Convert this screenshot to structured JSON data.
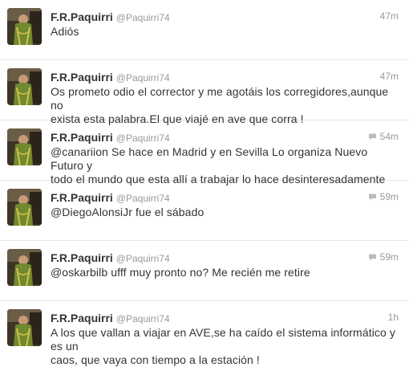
{
  "tweets": [
    {
      "name": "F.R.Paquirri",
      "handle": "@Paquirri74",
      "time": "47m",
      "has_reply_icon": false,
      "lines": [
        "Adiós"
      ]
    },
    {
      "name": "F.R.Paquirri",
      "handle": "@Paquirri74",
      "time": "47m",
      "has_reply_icon": false,
      "lines": [
        "Os prometo odio el corrector y me agotáis los corregidores,aunque no",
        "exista esta palabra.El que viajé en ave que corra !"
      ]
    },
    {
      "name": "F.R.Paquirri",
      "handle": "@Paquirri74",
      "time": "54m",
      "has_reply_icon": true,
      "lines": [
        "@canariion Se hace en Madrid y en Sevilla Lo organiza Nuevo Futuro y",
        "todo el mundo que esta allí a trabajar lo hace desinteresadamente"
      ]
    },
    {
      "name": "F.R.Paquirri",
      "handle": "@Paquirri74",
      "time": "59m",
      "has_reply_icon": true,
      "lines": [
        "@DiegoAlonsiJr fue el sábado"
      ]
    },
    {
      "name": "F.R.Paquirri",
      "handle": "@Paquirri74",
      "time": "59m",
      "has_reply_icon": true,
      "lines": [
        "@oskarbilb ufff muy pronto no? Me recién me retire"
      ]
    },
    {
      "name": "F.R.Paquirri",
      "handle": "@Paquirri74",
      "time": "1h",
      "has_reply_icon": false,
      "lines": [
        "A los que vallan a viajar en AVE,se ha caído el sistema informático y es un",
        "caos, que vaya con tiempo a la estación !"
      ]
    }
  ],
  "icons": {
    "reply": "reply-arrow-icon",
    "avatar": "bullfighter-avatar"
  },
  "colors": {
    "name": "#333333",
    "handle": "#999999",
    "text": "#333333",
    "divider": "#e6e6e6",
    "reply_icon": "#bbbbbb"
  }
}
